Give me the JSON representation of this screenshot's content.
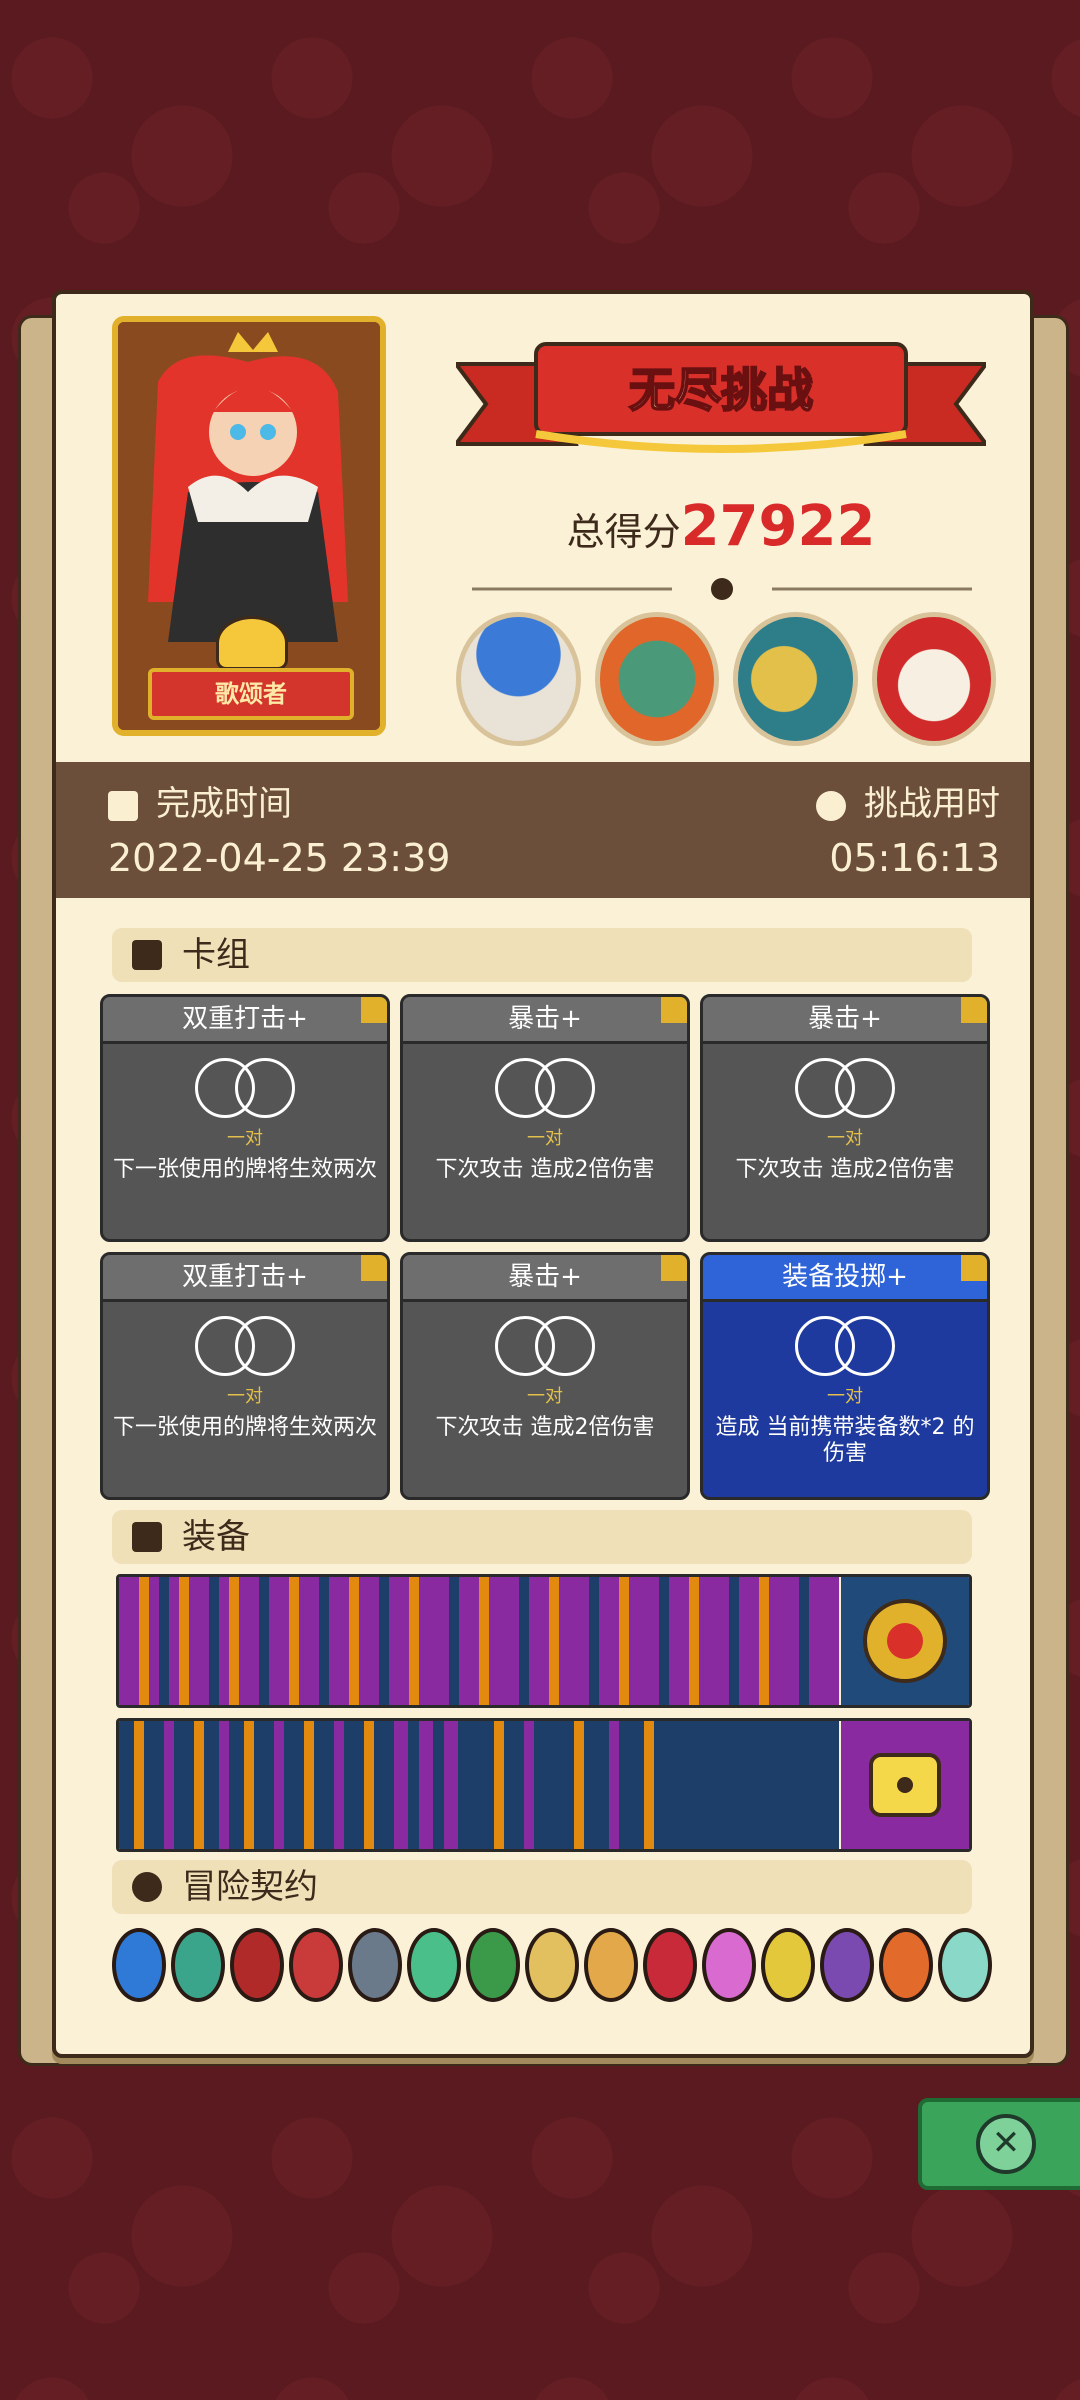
{
  "header": {
    "title": "无尽挑战",
    "score_label": "总得分",
    "score_value": "27922",
    "character_name": "歌颂者"
  },
  "stats": {
    "finish_label": "完成时间",
    "finish_value": "2022-04-25 23:39",
    "duration_label": "挑战用时",
    "duration_value": "05:16:13"
  },
  "sections": {
    "deck": "卡组",
    "equipment": "装备",
    "contracts": "冒险契约"
  },
  "cards": [
    {
      "name": "双重打击+",
      "pair": "一对",
      "desc": "下一张使用的牌将生效两次",
      "style": "gray"
    },
    {
      "name": "暴击+",
      "pair": "一对",
      "desc": "下次攻击 造成2倍伤害",
      "style": "gray"
    },
    {
      "name": "暴击+",
      "pair": "一对",
      "desc": "下次攻击 造成2倍伤害",
      "style": "gray"
    },
    {
      "name": "双重打击+",
      "pair": "一对",
      "desc": "下一张使用的牌将生效两次",
      "style": "gray"
    },
    {
      "name": "暴击+",
      "pair": "一对",
      "desc": "下次攻击 造成2倍伤害",
      "style": "gray"
    },
    {
      "name": "装备投掷+",
      "pair": "一对",
      "desc": "造成 当前携带装备数*2 的伤害",
      "style": "blue"
    }
  ],
  "colors": {
    "accent_red": "#d92a2a",
    "gold": "#e2b12c",
    "panel": "#faf1d7",
    "card_gray": "#555555",
    "card_blue": "#1f3a9e"
  }
}
